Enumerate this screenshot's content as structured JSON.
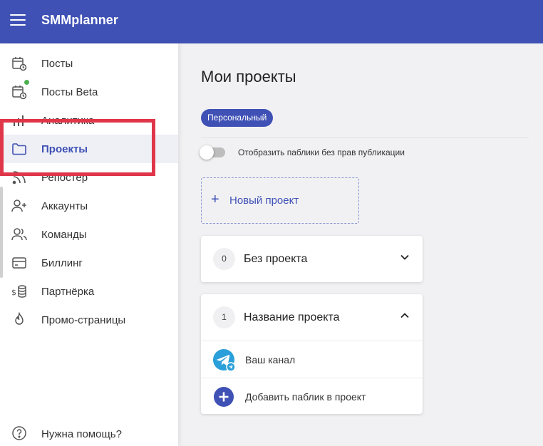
{
  "header": {
    "brand": "SMMplanner",
    "menu_icon": "hamburger-icon"
  },
  "sidebar": {
    "items": [
      {
        "label": "Посты",
        "icon": "calendar-clock-icon"
      },
      {
        "label": "Посты Beta",
        "icon": "calendar-clock-icon"
      },
      {
        "label": "Аналитика",
        "icon": "bar-chart-icon"
      },
      {
        "label": "Проекты",
        "icon": "folder-icon"
      },
      {
        "label": "Репостер",
        "icon": "rss-icon"
      },
      {
        "label": "Аккаунты",
        "icon": "user-plus-icon"
      },
      {
        "label": "Команды",
        "icon": "users-icon"
      },
      {
        "label": "Биллинг",
        "icon": "credit-card-icon"
      },
      {
        "label": "Партнёрка",
        "icon": "coins-icon"
      },
      {
        "label": "Промо-страницы",
        "icon": "flame-icon"
      }
    ],
    "help_label": "Нужна помощь?",
    "accent_color": "#3f51b5",
    "highlight_color": "#e0364a"
  },
  "main": {
    "title": "Мои проекты",
    "chip_label": "Персональный",
    "toggle_label": "Отобразить паблики без прав публикации",
    "toggle_on": false,
    "new_project_label": "Новый проект",
    "projects": [
      {
        "count": "0",
        "name": "Без проекта",
        "expanded": false
      },
      {
        "count": "1",
        "name": "Название проекта",
        "expanded": true,
        "rows": [
          {
            "label": "Ваш канал",
            "icon": "telegram-icon"
          },
          {
            "label": "Добавить паблик в проект",
            "icon": "add-circle-icon"
          }
        ]
      }
    ]
  }
}
